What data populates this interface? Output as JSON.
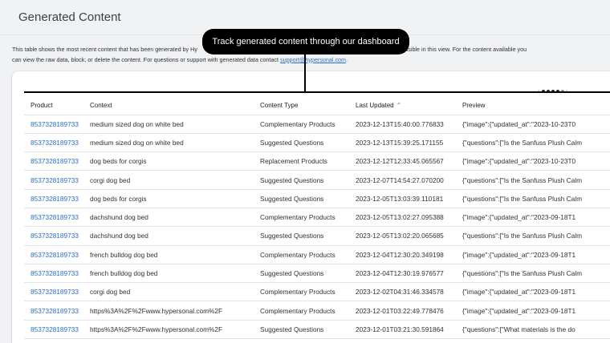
{
  "page": {
    "title": "Generated Content",
    "description_part1": "This table shows the most recent content that has been generated by Hy",
    "description_hidden_gap": "",
    "description_part2": "ing more content accessible in this view. For the content available you",
    "description_line2": "can view the raw data, block, or delete the content. For questions or support with generated data contact ",
    "support_email": "support@hypersonal.com",
    "description_end": "."
  },
  "tooltip": {
    "text": "Track generated content through our dashboard"
  },
  "table": {
    "columns": [
      {
        "label": "Product"
      },
      {
        "label": "Context"
      },
      {
        "label": "Content Type"
      },
      {
        "label": "Last Updated"
      },
      {
        "label": "Preview"
      }
    ],
    "sort_icon": "sort-up-icon",
    "rows": [
      {
        "product": "8537328189733",
        "context": "medium sized dog on white bed",
        "type": "Complementary Products",
        "updated": "2023-12-13T15:40:00.776833",
        "preview": "{\"image\":{\"updated_at\":\"2023-10-23T0"
      },
      {
        "product": "8537328189733",
        "context": "medium sized dog on white bed",
        "type": "Suggested Questions",
        "updated": "2023-12-13T15:39:25.171155",
        "preview": "{\"questions\":[\"Is the Sanfuss Plush Calm"
      },
      {
        "product": "8537328189733",
        "context": "dog beds for corgis",
        "type": "Replacement Products",
        "updated": "2023-12-12T12:33:45.065567",
        "preview": "{\"image\":{\"updated_at\":\"2023-10-23T0"
      },
      {
        "product": "8537328189733",
        "context": "corgi dog bed",
        "type": "Suggested Questions",
        "updated": "2023-12-07T14:54:27.070200",
        "preview": "{\"questions\":[\"Is the Sanfuss Plush Calm"
      },
      {
        "product": "8537328189733",
        "context": "dog beds for corgis",
        "type": "Suggested Questions",
        "updated": "2023-12-05T13:03:39.110181",
        "preview": "{\"questions\":[\"Is the Sanfuss Plush Calm"
      },
      {
        "product": "8537328189733",
        "context": "dachshund dog bed",
        "type": "Complementary Products",
        "updated": "2023-12-05T13:02:27.095388",
        "preview": "{\"image\":{\"updated_at\":\"2023-09-18T1"
      },
      {
        "product": "8537328189733",
        "context": "dachshund dog bed",
        "type": "Suggested Questions",
        "updated": "2023-12-05T13:02:20.065685",
        "preview": "{\"questions\":[\"Is the Sanfuss Plush Calm"
      },
      {
        "product": "8537328189733",
        "context": "french bulldog dog bed",
        "type": "Complementary Products",
        "updated": "2023-12-04T12:30:20.349198",
        "preview": "{\"image\":{\"updated_at\":\"2023-09-18T1"
      },
      {
        "product": "8537328189733",
        "context": "french bulldog dog bed",
        "type": "Suggested Questions",
        "updated": "2023-12-04T12:30:19.976577",
        "preview": "{\"questions\":[\"Is the Sanfuss Plush Calm"
      },
      {
        "product": "8537328189733",
        "context": "corgi dog bed",
        "type": "Complementary Products",
        "updated": "2023-12-02T04:31:46.334578",
        "preview": "{\"image\":{\"updated_at\":\"2023-09-18T1"
      },
      {
        "product": "8537328189733",
        "context": "https%3A%2F%2Fwww.hypersonal.com%2F",
        "type": "Complementary Products",
        "updated": "2023-12-01T03:22:49.778476",
        "preview": "{\"image\":{\"updated_at\":\"2023-09-18T1"
      },
      {
        "product": "8537328189733",
        "context": "https%3A%2F%2Fwww.hypersonal.com%2F",
        "type": "Suggested Questions",
        "updated": "2023-12-01T03:21:30.591864",
        "preview": "{\"questions\":[\"What materials is the do"
      }
    ]
  },
  "pager": {
    "prev_icon": "chevron-left-icon",
    "next_icon": "chevron-right-icon",
    "dots": 6
  }
}
